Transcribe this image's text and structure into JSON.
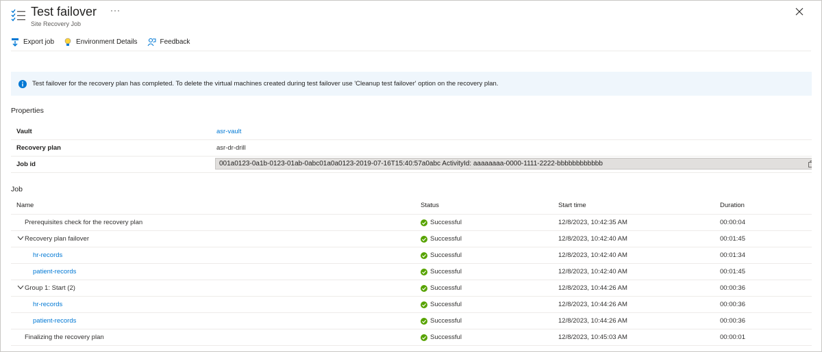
{
  "header": {
    "title": "Test failover",
    "subtitle": "Site Recovery Job",
    "more": "···"
  },
  "toolbar": {
    "export_label": "Export job",
    "env_label": "Environment Details",
    "feedback_label": "Feedback"
  },
  "banner": {
    "text": "Test failover for the recovery plan has completed. To delete the virtual machines created during test failover use 'Cleanup test failover' option on the recovery plan."
  },
  "properties": {
    "heading": "Properties",
    "vault_label": "Vault",
    "vault_value": "asr-vault",
    "plan_label": "Recovery plan",
    "plan_value": "asr-dr-drill",
    "jobid_label": "Job id",
    "jobid_value": "001a0123-0a1b-0123-01ab-0abc01a0a0123-2019-07-16T15:40:57a0abc ActivityId: aaaaaaaa-0000-1111-2222-bbbbbbbbbbbb"
  },
  "job": {
    "heading": "Job",
    "columns": {
      "name": "Name",
      "status": "Status",
      "start": "Start time",
      "duration": "Duration"
    },
    "rows": [
      {
        "name": "Prerequisites check for the recovery plan",
        "status": "Successful",
        "start": "12/8/2023, 10:42:35 AM",
        "duration": "00:00:04"
      },
      {
        "name": "Recovery plan failover",
        "status": "Successful",
        "start": "12/8/2023, 10:42:40 AM",
        "duration": "00:01:45"
      },
      {
        "name": "hr-records",
        "status": "Successful",
        "start": "12/8/2023, 10:42:40 AM",
        "duration": "00:01:34"
      },
      {
        "name": "patient-records",
        "status": "Successful",
        "start": "12/8/2023, 10:42:40 AM",
        "duration": "00:01:45"
      },
      {
        "name": "Group 1: Start (2)",
        "status": "Successful",
        "start": "12/8/2023, 10:44:26 AM",
        "duration": "00:00:36"
      },
      {
        "name": "hr-records",
        "status": "Successful",
        "start": "12/8/2023, 10:44:26 AM",
        "duration": "00:00:36"
      },
      {
        "name": "patient-records",
        "status": "Successful",
        "start": "12/8/2023, 10:44:26 AM",
        "duration": "00:00:36"
      },
      {
        "name": "Finalizing the recovery plan",
        "status": "Successful",
        "start": "12/8/2023, 10:45:03 AM",
        "duration": "00:00:01"
      }
    ]
  },
  "colors": {
    "accent": "#0078d4",
    "success": "#57a300",
    "banner_bg": "#eff6fc"
  }
}
